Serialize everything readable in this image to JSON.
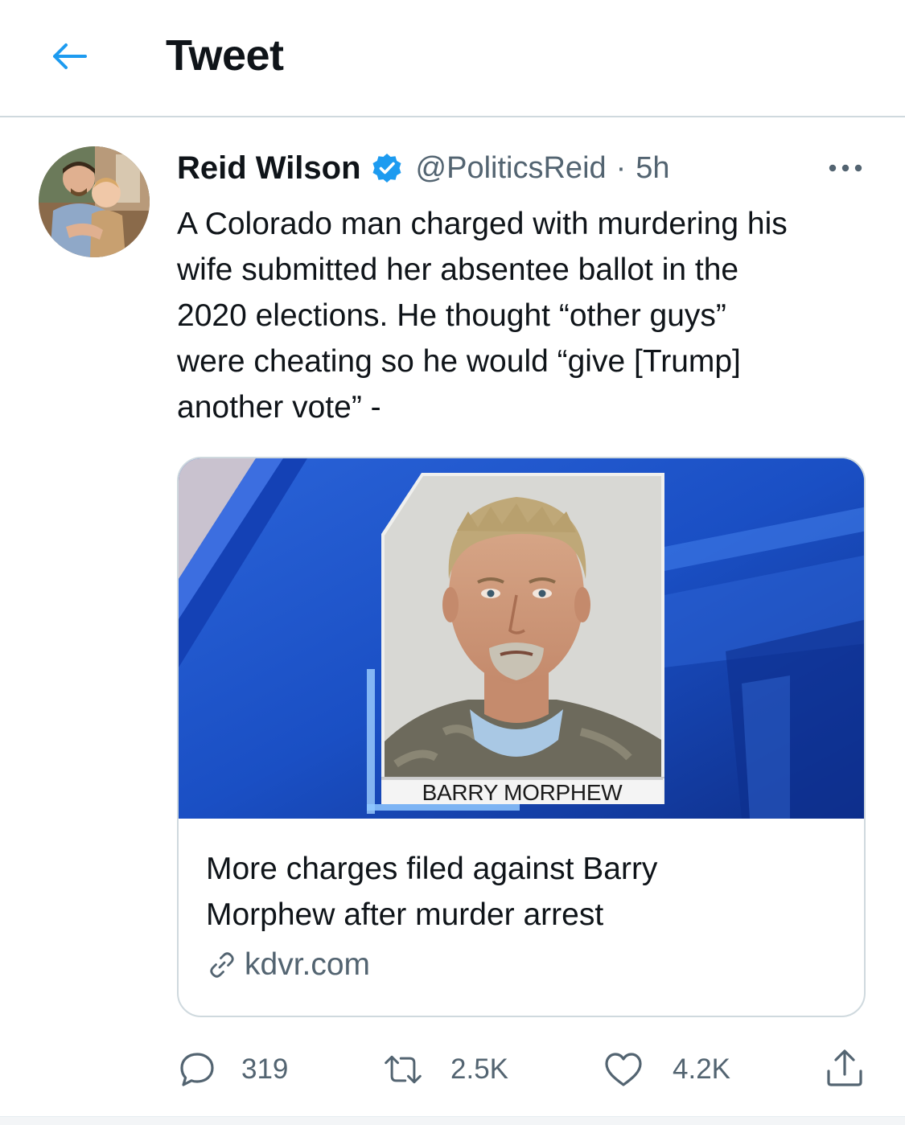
{
  "header": {
    "title": "Tweet",
    "back_icon": "arrow-left-icon"
  },
  "tweet": {
    "author_name": "Reid Wilson",
    "verified_icon": "verified-badge-icon",
    "handle": "@PoliticsReid",
    "separator": "·",
    "time": "5h",
    "more_icon": "more-horizontal-icon",
    "text_lines": [
      "A Colorado man charged with murdering his",
      "wife submitted her absentee ballot in the",
      "2020 elections. He thought “other guys”",
      "were cheating so he would “give [Trump]",
      "another vote” -"
    ]
  },
  "card": {
    "image_caption": "BARRY MORPHEW",
    "title_lines": [
      "More charges filed against Barry",
      "Morphew after murder arrest"
    ],
    "domain": "kdvr.com",
    "link_icon": "link-icon"
  },
  "actions": {
    "reply_count": "319",
    "retweet_count": "2.5K",
    "like_count": "4.2K",
    "icons": [
      "reply-icon",
      "retweet-icon",
      "like-icon",
      "share-icon"
    ]
  },
  "colors": {
    "accent": "#1d9bf0",
    "text_primary": "#0f1419",
    "text_secondary": "#536471",
    "border": "#cfd9de",
    "card_media_blue": "#1a4fc4"
  }
}
